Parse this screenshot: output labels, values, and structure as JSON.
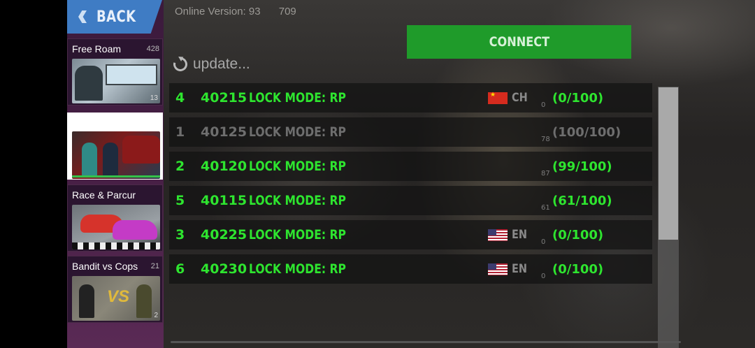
{
  "header": {
    "back_label": "BACK",
    "online_version_label": "Online Version: 93",
    "online_version_extra": "709",
    "connect_label": "CONNECT",
    "update_label": "update..."
  },
  "modes": [
    {
      "title": "Free Roam",
      "count": "428",
      "sub": "13",
      "selected": false
    },
    {
      "title": "",
      "count": "",
      "sub": "",
      "selected": true
    },
    {
      "title": "Race & Parcur",
      "count": "",
      "sub": "",
      "selected": false
    },
    {
      "title": "Bandit vs Cops",
      "count": "21",
      "sub": "2",
      "selected": false
    }
  ],
  "servers": [
    {
      "id": "4",
      "port": "40215",
      "mode": "LOCK MODE: RP",
      "flag": "flag-ch",
      "lang": "CH",
      "ping": "0",
      "players": "(0/100)",
      "state": "active"
    },
    {
      "id": "1",
      "port": "40125",
      "mode": "LOCK MODE: RP",
      "flag": "",
      "lang": "",
      "ping": "78",
      "players": "(100/100)",
      "state": "full"
    },
    {
      "id": "2",
      "port": "40120",
      "mode": "LOCK MODE: RP",
      "flag": "",
      "lang": "",
      "ping": "87",
      "players": "(99/100)",
      "state": "active"
    },
    {
      "id": "5",
      "port": "40115",
      "mode": "LOCK MODE: RP",
      "flag": "",
      "lang": "",
      "ping": "61",
      "players": "(61/100)",
      "state": "active"
    },
    {
      "id": "3",
      "port": "40225",
      "mode": "LOCK MODE: RP",
      "flag": "flag-en",
      "lang": "EN",
      "ping": "0",
      "players": "(0/100)",
      "state": "active"
    },
    {
      "id": "6",
      "port": "40230",
      "mode": "LOCK MODE: RP",
      "flag": "flag-en",
      "lang": "EN",
      "ping": "0",
      "players": "(0/100)",
      "state": "active"
    }
  ],
  "colors": {
    "active_text": "#2ee52f",
    "full_text": "#6e6e6e",
    "connect_bg": "#1f9b2a",
    "back_bg": "#3f7cc4"
  }
}
